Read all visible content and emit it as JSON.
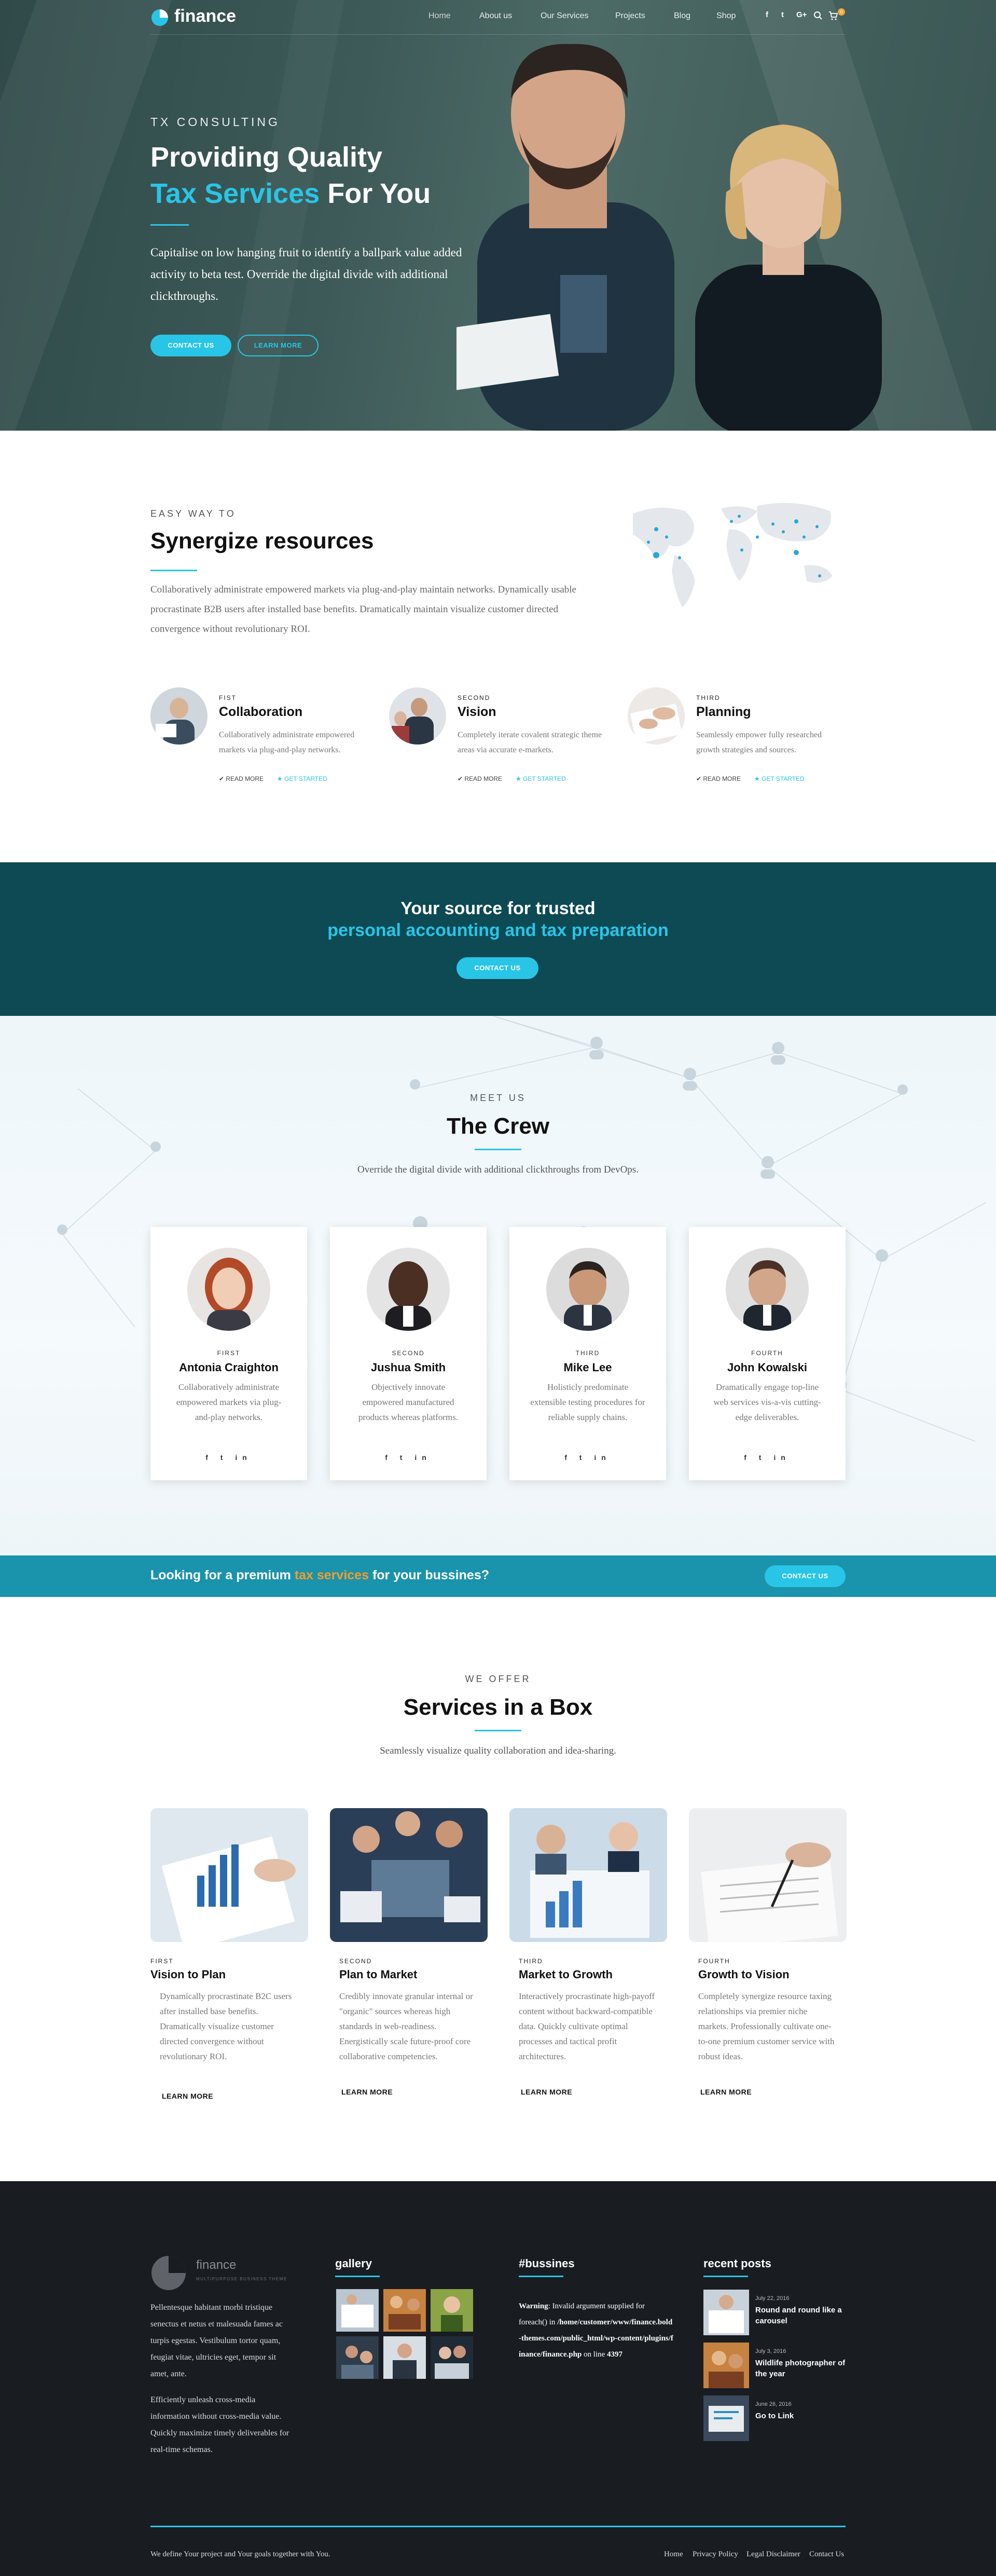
{
  "header": {
    "logo": "finance",
    "nav": [
      "Home",
      "About us",
      "Our Services",
      "Projects",
      "Blog",
      "Shop"
    ],
    "social": [
      "f",
      "t",
      "G+"
    ],
    "cart_count": "0"
  },
  "hero": {
    "eyebrow": "TX CONSULTING",
    "title_line1": "Providing Quality",
    "title_accent": "Tax Services",
    "title_rest": "For You",
    "text": "Capitalise on low hanging fruit to identify a ballpark value added activity to beta test. Override the digital divide with additional clickthroughs.",
    "btn_primary": "CONTACT US",
    "btn_secondary": "LEARN MORE"
  },
  "synergy": {
    "eyebrow": "EASY WAY TO",
    "title": "Synergize resources",
    "text": "Collaboratively administrate empowered markets via plug-and-play maintain networks. Dynamically usable procrastinate B2B users after installed base benefits. Dramatically maintain visualize customer directed convergence without revolutionary ROI.",
    "features": [
      {
        "order": "FIST",
        "title": "Collaboration",
        "text": "Collaboratively administrate empowered markets via plug-and-play networks.",
        "read": "READ MORE",
        "get": "GET STARTED"
      },
      {
        "order": "SECOND",
        "title": "Vision",
        "text": "Completely iterate covalent strategic theme areas via accurate e-markets.",
        "read": "READ MORE",
        "get": "GET STARTED"
      },
      {
        "order": "THIRD",
        "title": "Planning",
        "text": "Seamlessly empower fully researched growth strategies and sources.",
        "read": "READ MORE",
        "get": "GET STARTED"
      }
    ]
  },
  "cta": {
    "line1": "Your source for trusted",
    "line2": "personal accounting and tax preparation",
    "btn": "CONTACT US"
  },
  "crew": {
    "eyebrow": "MEET US",
    "title": "The Crew",
    "subtitle": "Override the digital divide with additional clickthroughs from DevOps.",
    "members": [
      {
        "order": "FIRST",
        "name": "Antonia Craighton",
        "text": "Collaboratively administrate empowered markets via plug-and-play networks."
      },
      {
        "order": "SECOND",
        "name": "Jushua Smith",
        "text": "Objectively innovate empowered manufactured products whereas platforms."
      },
      {
        "order": "THIRD",
        "name": "Mike Lee",
        "text": "Holisticly predominate extensible testing procedures for reliable supply chains."
      },
      {
        "order": "FOURTH",
        "name": "John Kowalski",
        "text": "Dramatically engage top-line web services vis-a-vis cutting-edge deliverables."
      }
    ],
    "social": "f t in"
  },
  "banner": {
    "pre": "Looking for a premium",
    "accent": "tax services",
    "post": "for your bussines?",
    "btn": "CONTACT US",
    "accent_color": "#f39c2d"
  },
  "services": {
    "eyebrow": "WE OFFER",
    "title": "Services in a Box",
    "subtitle": "Seamlessly visualize quality collaboration and idea-sharing.",
    "items": [
      {
        "order": "FIRST",
        "title": "Vision to Plan",
        "text": "Dynamically procrastinate B2C users after installed base benefits. Dramatically visualize customer directed convergence without revolutionary ROI.",
        "link": "LEARN MORE"
      },
      {
        "order": "SECOND",
        "title": "Plan to Market",
        "text": "Credibly innovate granular internal or \"organic\" sources whereas high standards in web-readiness. Energistically scale future-proof core collaborative competencies.",
        "link": "LEARN MORE"
      },
      {
        "order": "THIRD",
        "title": "Market to Growth",
        "text": "Interactively procrastinate high-payoff content without backward-compatible data. Quickly cultivate optimal processes and tactical profit architectures.",
        "link": "LEARN MORE"
      },
      {
        "order": "FOURTH",
        "title": "Growth to Vision",
        "text": "Completely synergize resource taxing relationships via premier niche markets. Professionally cultivate one-to-one premium customer service with robust ideas.",
        "link": "LEARN MORE"
      }
    ]
  },
  "footer": {
    "logo": "finance",
    "tagline": "MULTIPURPOSE BUSINESS THEME",
    "about1": "Pellentesque habitant morbi tristique senectus et netus et malesuada fames ac turpis egestas. Vestibulum tortor quam, feugiat vitae, ultricies eget, tempor sit amet, ante.",
    "about2": "Efficiently unleash cross-media information without cross-media value. Quickly maximize timely deliverables for real-time schemas.",
    "gallery_title": "gallery",
    "bussines_title": "#bussines",
    "warning_label": "Warning",
    "warning_text": ": Invalid argument supplied for foreach() in",
    "warning_path": "/home/customer/www/finance.bold-themes.com/public_html/wp-content/plugins/finance/finance.php",
    "warning_line_pre": "on line",
    "warning_line": "4397",
    "recent_title": "recent posts",
    "posts": [
      {
        "date": "July 22, 2016",
        "title": "Round and round like a carousel"
      },
      {
        "date": "July 3, 2016",
        "title": "Wildlife photographer of the year"
      },
      {
        "date": "June 26, 2016",
        "title": "Go to Link"
      }
    ],
    "copyright": "We define Your project and Your goals together with You.",
    "links": [
      "Home",
      "Privacy Policy",
      "Legal Disclaimer",
      "Contact Us"
    ]
  }
}
